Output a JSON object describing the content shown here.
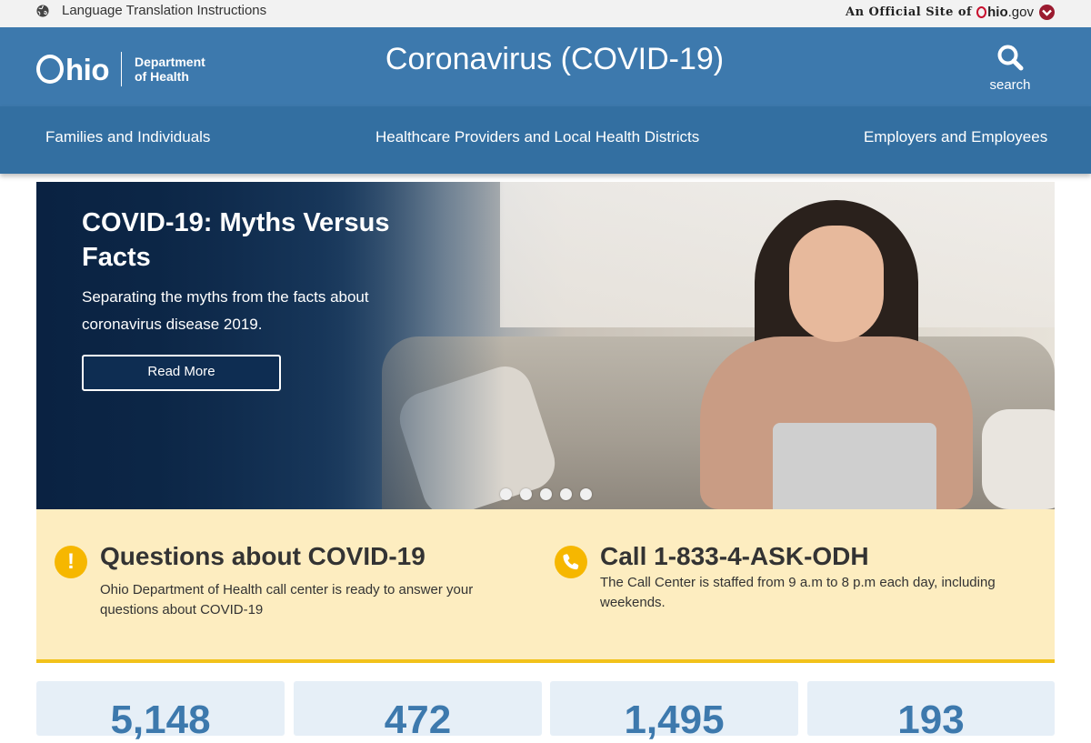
{
  "topbar": {
    "language_link": "Language Translation Instructions",
    "official_prefix": "An Official Site of",
    "ohio_gov_bold": "hio",
    "ohio_gov_suffix": ".gov"
  },
  "header": {
    "logo_word": "hio",
    "department_line1": "Department",
    "department_line2": "of Health",
    "title": "Coronavirus (COVID-19)",
    "search_label": "search"
  },
  "nav": {
    "items": [
      {
        "label": "Families and Individuals"
      },
      {
        "label": "Healthcare Providers and Local Health Districts"
      },
      {
        "label": "Employers and Employees"
      }
    ]
  },
  "hero": {
    "title": "COVID-19: Myths Versus Facts",
    "text": "Separating the myths from the facts about coronavirus disease 2019.",
    "button": "Read More",
    "slide_count": 5
  },
  "alert": {
    "questions": {
      "icon": "exclamation-icon",
      "heading": "Questions about COVID-19",
      "text": "Ohio Department of Health call center is ready to answer your questions about COVID-19"
    },
    "call": {
      "icon": "phone-icon",
      "heading": "Call 1-833-4-ASK-ODH",
      "text": "The Call Center is staffed from 9 a.m to 8 p.m each day, including weekends."
    }
  },
  "stats": [
    {
      "value": "5,148"
    },
    {
      "value": "472"
    },
    {
      "value": "1,495"
    },
    {
      "value": "193"
    }
  ],
  "colors": {
    "header_blue": "#3d79ad",
    "nav_blue": "#336fa1",
    "alert_bg": "#fdedc0",
    "alert_accent": "#f2c21b",
    "ohio_red": "#c8102e"
  }
}
